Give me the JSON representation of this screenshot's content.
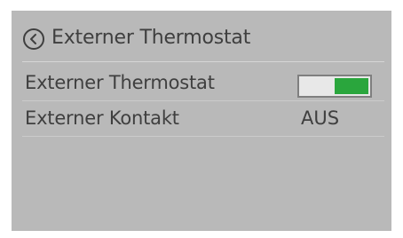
{
  "header": {
    "title": "Externer Thermostat",
    "back_icon": "chevron-left-circle-icon"
  },
  "settings": [
    {
      "label": "Externer Thermostat",
      "control": "toggle",
      "state": "on"
    },
    {
      "label": "Externer Kontakt",
      "value": "AUS"
    }
  ],
  "colors": {
    "screen_background": "#b9b9b9",
    "text": "#3f3f3f",
    "toggle_on": "#2aa63d"
  }
}
